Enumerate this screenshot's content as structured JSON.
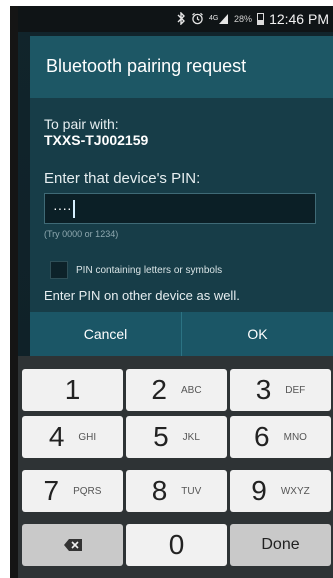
{
  "status_bar": {
    "icons": [
      "bluetooth-icon",
      "alarm-icon",
      "signal-icon",
      "battery-icon"
    ],
    "battery_percent": "28%",
    "time": "12:46 PM"
  },
  "dialog": {
    "title": "Bluetooth pairing request",
    "pair_with_label": "To pair with:",
    "device_name": "TXXS-TJ002159",
    "pin_prompt": "Enter that device's PIN:",
    "pin_value": "····",
    "pin_hint": "(Try 0000 or 1234)",
    "checkbox_label": "PIN containing letters or symbols",
    "other_device_note": "Enter PIN on other device as well.",
    "cancel_label": "Cancel",
    "ok_label": "OK"
  },
  "keypad": {
    "keys": [
      {
        "digit": "1",
        "letters": ""
      },
      {
        "digit": "2",
        "letters": "ABC"
      },
      {
        "digit": "3",
        "letters": "DEF"
      },
      {
        "digit": "4",
        "letters": "GHI"
      },
      {
        "digit": "5",
        "letters": "JKL"
      },
      {
        "digit": "6",
        "letters": "MNO"
      },
      {
        "digit": "7",
        "letters": "PQRS"
      },
      {
        "digit": "8",
        "letters": "TUV"
      },
      {
        "digit": "9",
        "letters": "WXYZ"
      },
      {
        "digit": "0",
        "letters": ""
      }
    ],
    "done_label": "Done",
    "backspace_icon": "backspace-icon"
  },
  "colors": {
    "dialog_bg": "#173d48",
    "dialog_title_bg": "#1d5765",
    "button_bar": "#1b5666",
    "keypad_bg": "#2e3335",
    "key_bg": "#f1f1f1"
  }
}
